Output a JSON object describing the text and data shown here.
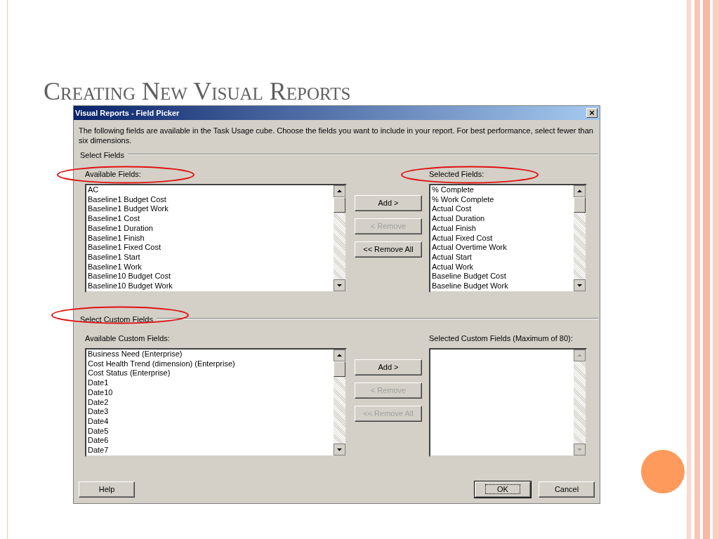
{
  "slide": {
    "title": "Creating New Visual Reports"
  },
  "dialog": {
    "title": "Visual Reports - Field Picker",
    "close": "×",
    "description": "The following fields are available in the Task Usage cube. Choose the fields you want to include in your report. For best performance, select fewer than six dimensions.",
    "sections": [
      {
        "title": "Select Fields",
        "available_label": "Available Fields:",
        "available_label_circled": true,
        "selected_label": "Selected Fields:",
        "selected_label_circled": true,
        "available": [
          "AC",
          "Baseline1 Budget Cost",
          "Baseline1 Budget Work",
          "Baseline1 Cost",
          "Baseline1 Duration",
          "Baseline1 Finish",
          "Baseline1 Fixed Cost",
          "Baseline1 Start",
          "Baseline1 Work",
          "Baseline10 Budget Cost",
          "Baseline10 Budget Work"
        ],
        "selected": [
          "% Complete",
          "% Work Complete",
          "Actual Cost",
          "Actual Duration",
          "Actual Finish",
          "Actual Fixed Cost",
          "Actual Overtime Work",
          "Actual Start",
          "Actual Work",
          "Baseline Budget Cost",
          "Baseline Budget Work"
        ],
        "buttons": [
          {
            "label": "Add >",
            "disabled": false
          },
          {
            "label": "< Remove",
            "disabled": true
          },
          {
            "label": "<< Remove All",
            "disabled": false
          }
        ]
      },
      {
        "title": "Select Custom Fields",
        "title_circled": true,
        "available_label": "Available Custom Fields:",
        "selected_label": "Selected Custom Fields (Maximum of 80):",
        "available": [
          "Business Need (Enterprise)",
          "Cost Health Trend (dimension) (Enterprise)",
          "Cost Status (Enterprise)",
          "Date1",
          "Date10",
          "Date2",
          "Date3",
          "Date4",
          "Date5",
          "Date6",
          "Date7"
        ],
        "buttons": [
          {
            "label": "Add >",
            "disabled": false
          },
          {
            "label": "< Remove",
            "disabled": true
          },
          {
            "label": "<< Remove All",
            "disabled": true
          }
        ]
      }
    ],
    "footer_buttons": [
      {
        "label": "Help",
        "default": false
      },
      {
        "label": "OK",
        "default": true
      },
      {
        "label": "Cancel",
        "default": false
      }
    ]
  }
}
